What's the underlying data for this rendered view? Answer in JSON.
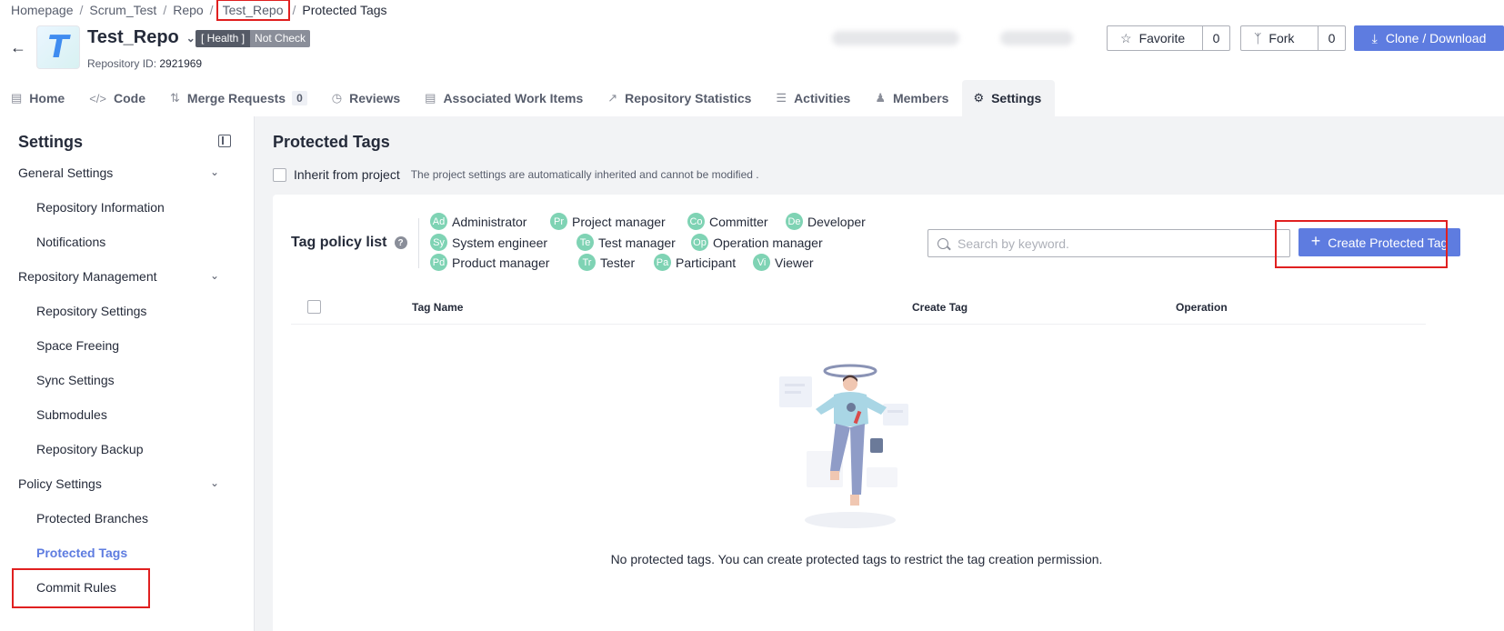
{
  "breadcrumb": [
    "Homepage",
    "Scrum_Test",
    "Repo",
    "Test_Repo",
    "Protected Tags"
  ],
  "repo": {
    "logo_letter": "T",
    "name": "Test_Repo",
    "health_label": "[ Health ]",
    "health_status": "Not Check",
    "id_label": "Repository ID:",
    "id_value": "2921969"
  },
  "actions": {
    "favorite_label": "Favorite",
    "favorite_count": "0",
    "fork_label": "Fork",
    "fork_count": "0",
    "clone_label": "Clone / Download"
  },
  "tabs": [
    {
      "label": "Home",
      "icon": "home-icon"
    },
    {
      "label": "Code",
      "icon": "code-icon"
    },
    {
      "label": "Merge Requests",
      "icon": "merge-icon",
      "count": "0"
    },
    {
      "label": "Reviews",
      "icon": "review-icon"
    },
    {
      "label": "Associated Work Items",
      "icon": "document-icon"
    },
    {
      "label": "Repository Statistics",
      "icon": "chart-icon"
    },
    {
      "label": "Activities",
      "icon": "list-icon"
    },
    {
      "label": "Members",
      "icon": "user-icon"
    },
    {
      "label": "Settings",
      "icon": "gear-icon",
      "active": true
    }
  ],
  "sidebar": {
    "title": "Settings",
    "groups": [
      {
        "label": "General Settings",
        "items": [
          "Repository Information",
          "Notifications"
        ]
      },
      {
        "label": "Repository Management",
        "items": [
          "Repository Settings",
          "Space Freeing",
          "Sync Settings",
          "Submodules",
          "Repository Backup"
        ]
      },
      {
        "label": "Policy Settings",
        "items": [
          "Protected Branches",
          "Protected Tags",
          "Commit Rules"
        ]
      }
    ],
    "active_item": "Protected Tags"
  },
  "main": {
    "title": "Protected Tags",
    "inherit_label": "Inherit from project",
    "inherit_note": "The project settings are automatically inherited and cannot be modified .",
    "policy_label": "Tag policy list",
    "roles": [
      {
        "abbr": "Ad",
        "label": "Administrator"
      },
      {
        "abbr": "Pr",
        "label": "Project manager"
      },
      {
        "abbr": "Co",
        "label": "Committer"
      },
      {
        "abbr": "De",
        "label": "Developer"
      },
      {
        "abbr": "Sy",
        "label": "System engineer"
      },
      {
        "abbr": "Te",
        "label": "Test manager"
      },
      {
        "abbr": "Op",
        "label": "Operation manager"
      },
      {
        "abbr": "Pd",
        "label": "Product manager"
      },
      {
        "abbr": "Tr",
        "label": "Tester"
      },
      {
        "abbr": "Pa",
        "label": "Participant"
      },
      {
        "abbr": "Vi",
        "label": "Viewer"
      }
    ],
    "search_placeholder": "Search by keyword.",
    "create_button": "Create Protected Tag",
    "columns": [
      "Tag Name",
      "Create Tag",
      "Operation"
    ],
    "empty_text": "No protected tags. You can create protected tags to restrict the tag creation permission."
  },
  "colors": {
    "primary": "#5e7ce0",
    "role_avatar": "#7fd3b4",
    "highlight": "#e02020"
  }
}
